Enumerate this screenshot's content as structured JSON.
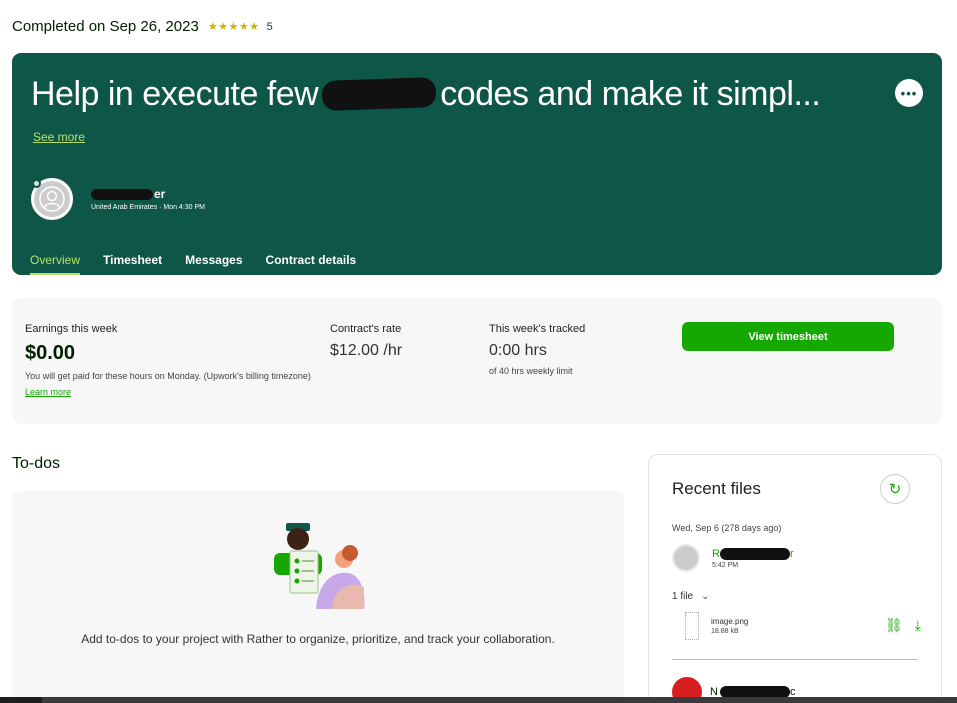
{
  "status": {
    "completed_text": "Completed on Sep 26, 2023",
    "stars": "★★★★★",
    "rating": "5"
  },
  "hero": {
    "title_part1": "Help in execute few",
    "title_part2": "codes and make it simpl...",
    "more_icon": "more-horizontal-icon",
    "see_more": "See more",
    "client_name_suffix": "er",
    "client_location_time": "United Arab Emirates · Mon 4:30 PM",
    "tabs": [
      {
        "label": "Overview"
      },
      {
        "label": "Timesheet"
      },
      {
        "label": "Messages"
      },
      {
        "label": "Contract details"
      }
    ]
  },
  "earnings": {
    "earnings_label": "Earnings this week",
    "earnings_value": "$0.00",
    "earnings_note": "You will get paid for these hours on Monday. (Upwork's billing timezone)",
    "learn_more": "Learn more",
    "rate_label": "Contract's rate",
    "rate_value": "$12.00 /hr",
    "tracked_label": "This week's tracked",
    "tracked_value": "0:00 hrs",
    "tracked_note": "of 40 hrs weekly limit",
    "view_button": "View timesheet"
  },
  "todos": {
    "title": "To-dos",
    "text": "Add to-dos to your project with Rather to organize, prioritize, and track your collaboration."
  },
  "files": {
    "title": "Recent files",
    "date": "Wed, Sep 6  (278 days ago)",
    "uploader_prefix": "R",
    "uploader_suffix": "r",
    "uploader_time": "5:42 PM",
    "file_count": "1 file",
    "file_name": "image.png",
    "file_size": "18.88 kB",
    "uploader2_prefix": "N",
    "uploader2_suffix": "c"
  },
  "colors": {
    "hero_bg": "#0e5647",
    "accent_green": "#14a800",
    "lime": "#b7e26f",
    "star": "#d4b106"
  }
}
